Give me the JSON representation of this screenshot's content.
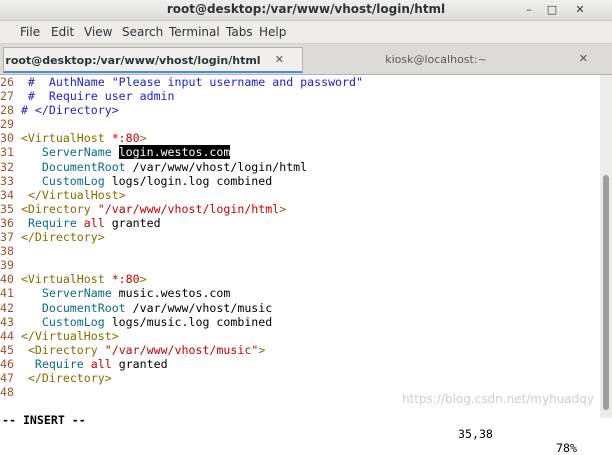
{
  "window": {
    "title": "root@desktop:/var/www/vhost/login/html",
    "minimize": "–",
    "maximize": "□",
    "close": "✕"
  },
  "menu": [
    "File",
    "Edit",
    "View",
    "Search",
    "Terminal",
    "Tabs",
    "Help"
  ],
  "tabs": [
    {
      "label": "root@desktop:/var/www/vhost/login/html",
      "close": "✕"
    },
    {
      "label": "kiosk@localhost:~",
      "close": "✕"
    }
  ],
  "editor": {
    "lines": [
      {
        "n": "26",
        "text": " #  AuthName \"Please input username and password\""
      },
      {
        "n": "27",
        "text": " #  Require user admin"
      },
      {
        "n": "28",
        "text": "# </Directory>"
      },
      {
        "n": "29",
        "text": ""
      },
      {
        "n": "30",
        "text": "<VirtualHost *:80>"
      },
      {
        "n": "31",
        "text": "   ServerName login.westos.com"
      },
      {
        "n": "32",
        "text": "   DocumentRoot /var/www/vhost/login/html"
      },
      {
        "n": "33",
        "text": "   CustomLog logs/login.log combined"
      },
      {
        "n": "34",
        "text": " </VirtualHost>"
      },
      {
        "n": "35",
        "text": "<Directory \"/var/www/vhost/login/html\">"
      },
      {
        "n": "36",
        "text": " Require all granted"
      },
      {
        "n": "37",
        "text": "</Directory>"
      },
      {
        "n": "38",
        "text": ""
      },
      {
        "n": "39",
        "text": ""
      },
      {
        "n": "40",
        "text": "<VirtualHost *:80>"
      },
      {
        "n": "41",
        "text": "   ServerName music.westos.com"
      },
      {
        "n": "42",
        "text": "   DocumentRoot /var/www/vhost/music"
      },
      {
        "n": "43",
        "text": "   CustomLog logs/music.log combined"
      },
      {
        "n": "44",
        "text": "</VirtualHost>"
      },
      {
        "n": "45",
        "text": " <Directory \"/var/www/vhost/music\">"
      },
      {
        "n": "46",
        "text": "  Require all granted"
      },
      {
        "n": "47",
        "text": " </Directory>"
      },
      {
        "n": "48",
        "text": ""
      }
    ],
    "mode": "-- INSERT --",
    "position": "35,38",
    "percent": "78%"
  },
  "watermark": "https://blog.csdn.net/myhuadqy"
}
